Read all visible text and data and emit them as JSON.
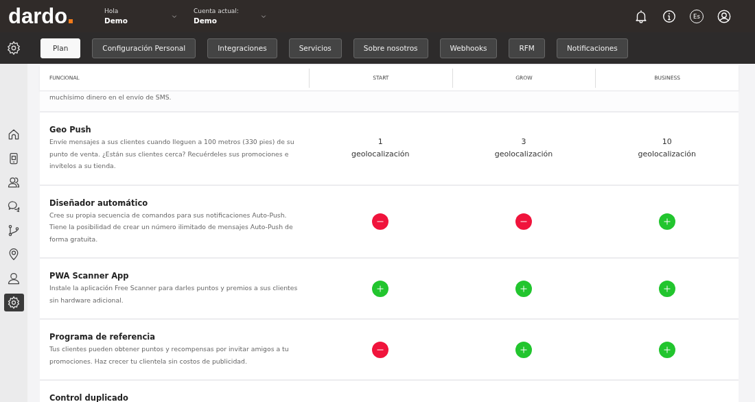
{
  "header": {
    "logo": "dardo",
    "greeting": {
      "label": "Hola",
      "value": "Demo"
    },
    "account": {
      "label": "Cuenta actual:",
      "value": "Demo"
    },
    "language": "Es"
  },
  "tabs": [
    {
      "label": "Plan",
      "selected": true
    },
    {
      "label": "Configuración Personal",
      "selected": false
    },
    {
      "label": "Integraciones",
      "selected": false
    },
    {
      "label": "Servicios",
      "selected": false
    },
    {
      "label": "Sobre nosotros",
      "selected": false
    },
    {
      "label": "Webhooks",
      "selected": false
    },
    {
      "label": "RFM",
      "selected": false
    },
    {
      "label": "Notificaciones",
      "selected": false
    }
  ],
  "sidebar": {
    "items": [
      {
        "kind": "home",
        "selected": false
      },
      {
        "kind": "phone",
        "selected": false
      },
      {
        "kind": "users",
        "selected": false
      },
      {
        "kind": "chat",
        "selected": false
      },
      {
        "kind": "branch",
        "selected": false
      },
      {
        "kind": "pin",
        "selected": false
      },
      {
        "kind": "user",
        "selected": false
      },
      {
        "kind": "gear",
        "selected": true
      }
    ]
  },
  "table": {
    "columns": [
      "FUNCIONAL",
      "START",
      "GROW",
      "BUSINESS"
    ],
    "rows": [
      {
        "description": "muchísimo dinero en el envío de SMS."
      },
      {
        "title": "Geo Push",
        "description": "Envíe mensajes a sus clientes cuando lleguen a 100 metros (330 pies) de su punto de venta. ¿Están sus clientes cerca? Recuérdeles sus promociones e invítelos a su tienda.",
        "cells": [
          {
            "kind": "count",
            "amount": "1",
            "unit": "geolocalización"
          },
          {
            "kind": "count",
            "amount": "3",
            "unit": "geolocalización"
          },
          {
            "kind": "count",
            "amount": "10",
            "unit": "geolocalización"
          }
        ]
      },
      {
        "title": "Diseñador automático",
        "description": "Cree su propia secuencia de comandos para sus notificaciones Auto-Push. Tiene la posibilidad de crear un número ilimitado de mensajes Auto-Push de forma gratuita.",
        "cells": [
          {
            "kind": "excluded"
          },
          {
            "kind": "excluded"
          },
          {
            "kind": "included"
          }
        ]
      },
      {
        "title": "PWA Scanner App",
        "description": "Instale la aplicación Free Scanner para darles puntos y premios a sus clientes sin hardware adicional.",
        "cells": [
          {
            "kind": "included"
          },
          {
            "kind": "included"
          },
          {
            "kind": "included"
          }
        ]
      },
      {
        "title": "Programa de referencia",
        "description": "Tus clientes pueden obtener puntos y recompensas por invitar amigos a tu promociones. Haz crecer tu clientela sin costos de publicidad.",
        "cells": [
          {
            "kind": "excluded"
          },
          {
            "kind": "included"
          },
          {
            "kind": "included"
          }
        ]
      },
      {
        "title": "Control duplicado"
      }
    ]
  }
}
